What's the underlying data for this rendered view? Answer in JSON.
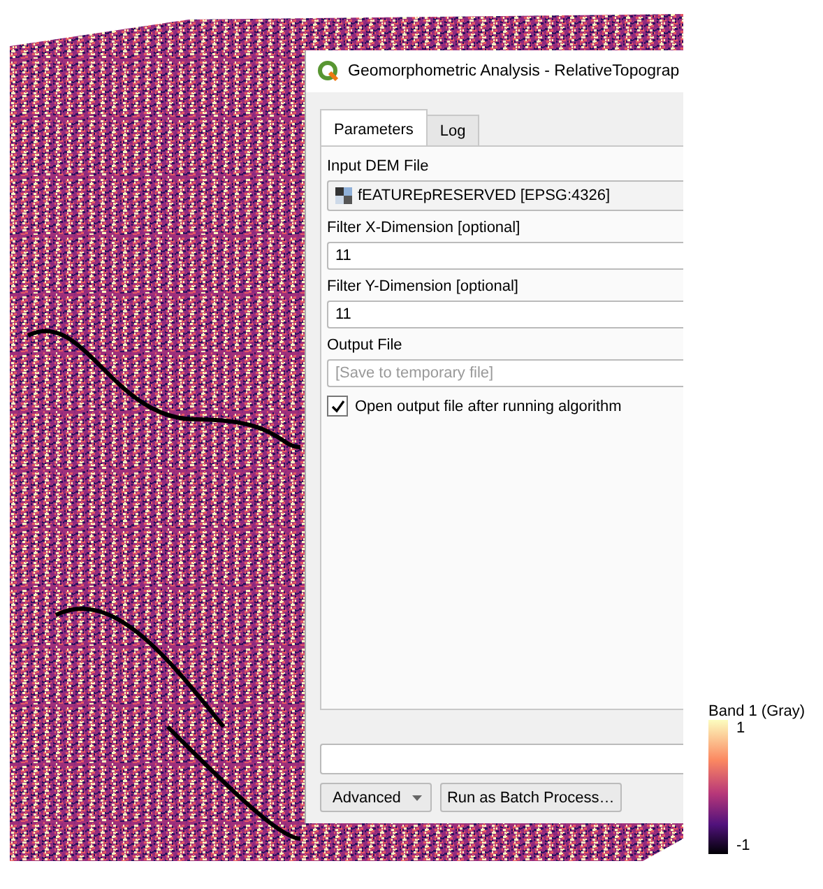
{
  "dialog": {
    "title": "Geomorphometric Analysis - RelativeTopograp",
    "tabs": [
      {
        "label": "Parameters",
        "selected": true
      },
      {
        "label": "Log",
        "selected": false
      }
    ],
    "parameters": [
      {
        "kind": "layer",
        "label": "Input DEM File",
        "value": "fEATUREpRESERVED [EPSG:4326]"
      },
      {
        "kind": "number",
        "label": "Filter X-Dimension [optional]",
        "value": "11"
      },
      {
        "kind": "number",
        "label": "Filter Y-Dimension [optional]",
        "value": "11"
      },
      {
        "kind": "file",
        "label": "Output File",
        "placeholder": "[Save to temporary file]"
      }
    ],
    "open_output": {
      "label": "Open output file after running algorithm",
      "checked": true
    },
    "progress": {
      "level": 0
    },
    "buttons": [
      {
        "kind": "dropdown",
        "label": "Advanced"
      },
      {
        "kind": "plain",
        "label": "Run as Batch Process…"
      }
    ]
  },
  "legend": {
    "title": "Band 1 (Gray)",
    "max_label": "1",
    "min_label": "-1"
  }
}
